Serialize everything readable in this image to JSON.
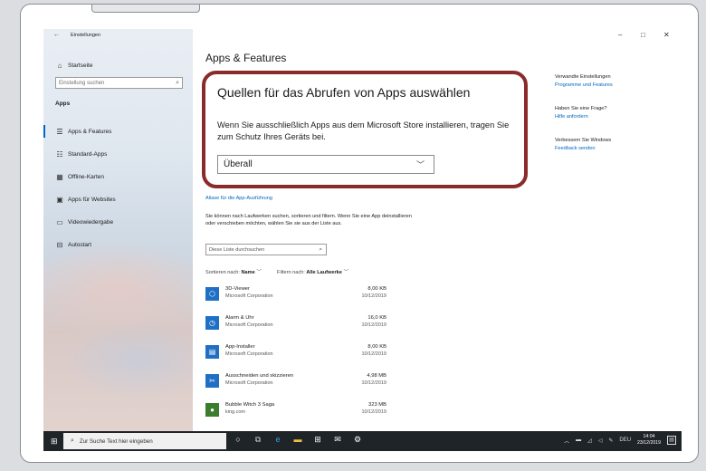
{
  "window": {
    "title": "Einstellungen",
    "back_icon": "back-arrow-icon",
    "controls": {
      "minimize": "–",
      "maximize": "□",
      "close": "✕"
    }
  },
  "sidebar": {
    "home": "Startseite",
    "search_placeholder": "Einstellung suchen",
    "section": "Apps",
    "items": [
      {
        "label": "Apps & Features",
        "icon": "list-icon"
      },
      {
        "label": "Standard-Apps",
        "icon": "default-apps-icon"
      },
      {
        "label": "Offline-Karten",
        "icon": "map-icon"
      },
      {
        "label": "Apps für Websites",
        "icon": "website-icon"
      },
      {
        "label": "Videowiedergabe",
        "icon": "video-icon"
      },
      {
        "label": "Autostart",
        "icon": "startup-icon"
      }
    ]
  },
  "main": {
    "title": "Apps & Features",
    "callout": {
      "heading": "Quellen für das Abrufen von Apps auswählen",
      "description": "Wenn Sie ausschließlich Apps aus dem Microsoft Store installieren, tragen Sie zum Schutz Ihres Geräts bei.",
      "select_value": "Überall"
    },
    "alias_link": "Aliase für die App-Ausführung",
    "paragraph": "Sie können nach Laufwerken suchen, sortieren und filtern. Wenn Sie eine App deinstallieren oder verschieben möchten, wählen Sie sie aus der Liste aus.",
    "list_search_placeholder": "Diese Liste durchsuchen",
    "sort_label": "Sortieren nach:",
    "sort_value": "Name",
    "filter_label": "Filtern nach:",
    "filter_value": "Alle Laufwerke",
    "apps": [
      {
        "name": "3D-Viewer",
        "publisher": "Microsoft Corporation",
        "size": "8,00 KB",
        "date": "10/12/2019",
        "icon": "cube-icon",
        "color": "#1f6fc5"
      },
      {
        "name": "Alarm & Uhr",
        "publisher": "Microsoft Corporation",
        "size": "16,0 KB",
        "date": "10/12/2019",
        "icon": "clock-icon",
        "color": "#1f6fc5"
      },
      {
        "name": "App-Installer",
        "publisher": "Microsoft Corporation",
        "size": "8,00 KB",
        "date": "10/12/2019",
        "icon": "package-icon",
        "color": "#1f6fc5"
      },
      {
        "name": "Ausschneiden und skizzieren",
        "publisher": "Microsoft Corporation",
        "size": "4,98 MB",
        "date": "10/12/2019",
        "icon": "snip-icon",
        "color": "#1f6fc5"
      },
      {
        "name": "Bubble Witch 3 Saga",
        "publisher": "king.com",
        "size": "323 MB",
        "date": "10/12/2019",
        "icon": "game-icon",
        "color": "#3a7d2c"
      }
    ]
  },
  "right": {
    "related_heading": "Verwandte Einstellungen",
    "related_link": "Programme und Features",
    "question_heading": "Haben Sie eine Frage?",
    "question_link": "Hilfe anfordern",
    "improve_heading": "Verbessern Sie Windows",
    "improve_link": "Feedback senden"
  },
  "taskbar": {
    "search_placeholder": "Zur Suche Text hier eingeben",
    "lang": "DEU",
    "time": "14:04",
    "date": "23/12/2019"
  },
  "colors": {
    "accent": "#0067c0",
    "callout_border": "#8b2a2a",
    "taskbar": "#1f2428"
  }
}
